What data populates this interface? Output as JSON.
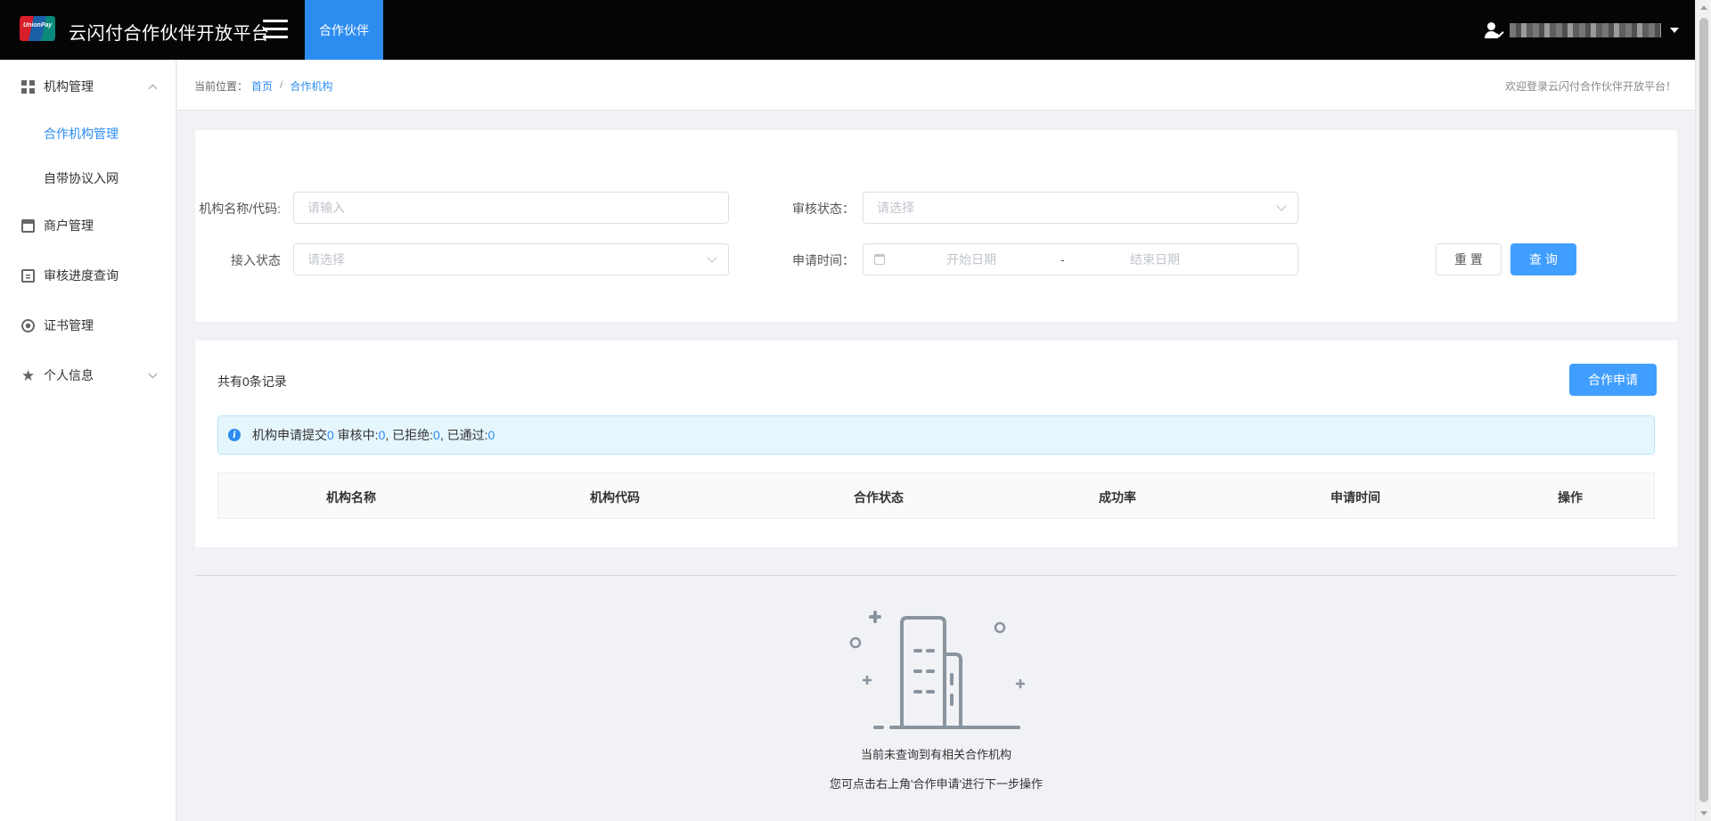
{
  "header": {
    "logo_text": "UnionPay",
    "app_title": "云闪付合作伙伴开放平台",
    "menu_toggle_icon": "hamburger-icon",
    "active_tab": "合作伙伴",
    "user_icon": "user-check-icon",
    "user_name_redacted": true
  },
  "sidebar": {
    "groups": [
      {
        "label": "机构管理",
        "icon": "grid-icon",
        "expanded": true,
        "children": [
          {
            "label": "合作机构管理",
            "active": true
          },
          {
            "label": "自带协议入网",
            "active": false
          }
        ]
      },
      {
        "label": "商户管理",
        "icon": "shop-icon"
      },
      {
        "label": "审核进度查询",
        "icon": "clipboard-icon"
      },
      {
        "label": "证书管理",
        "icon": "certificate-icon"
      },
      {
        "label": "个人信息",
        "icon": "star-icon",
        "expanded": false
      }
    ]
  },
  "breadcrumb": {
    "prefix": "当前位置：",
    "items": [
      "首页",
      "合作机构"
    ],
    "separator": "/"
  },
  "welcome": "欢迎登录云闪付合作伙伴开放平台！",
  "search": {
    "name_label": "机构名称/代码:",
    "name_placeholder": "请输入",
    "audit_label": "审核状态：",
    "audit_placeholder": "请选择",
    "access_label": "接入状态",
    "access_placeholder": "请选择",
    "apply_time_label": "申请时间：",
    "start_placeholder": "开始日期",
    "range_sep": "-",
    "end_placeholder": "结束日期",
    "reset_button": "重 置",
    "query_button": "查 询"
  },
  "results": {
    "record_count": "共有0条记录",
    "apply_button": "合作申请",
    "alert": {
      "icon": "info-icon",
      "submitted_label": "机构申请提交",
      "submitted_value": "0",
      "reviewing_label": " 审核中:",
      "reviewing_value": "0",
      "rejected_label": ", 已拒绝:",
      "rejected_value": "0",
      "passed_label": ", 已通过:",
      "passed_value": "0"
    },
    "columns": [
      "机构名称",
      "机构代码",
      "合作状态",
      "成功率",
      "申请时间",
      "操作"
    ]
  },
  "empty_state": {
    "illustration": "empty-building-icon",
    "line1": "当前未查询到有相关合作机构",
    "line2": "您可点击右上角'合作申请'进行下一步操作"
  },
  "colors": {
    "primary": "#2d8cf0",
    "button_blue": "#409eff",
    "header_bg": "#050505",
    "alert_bg": "#e5f6fd",
    "illustration": "#8a949e"
  }
}
